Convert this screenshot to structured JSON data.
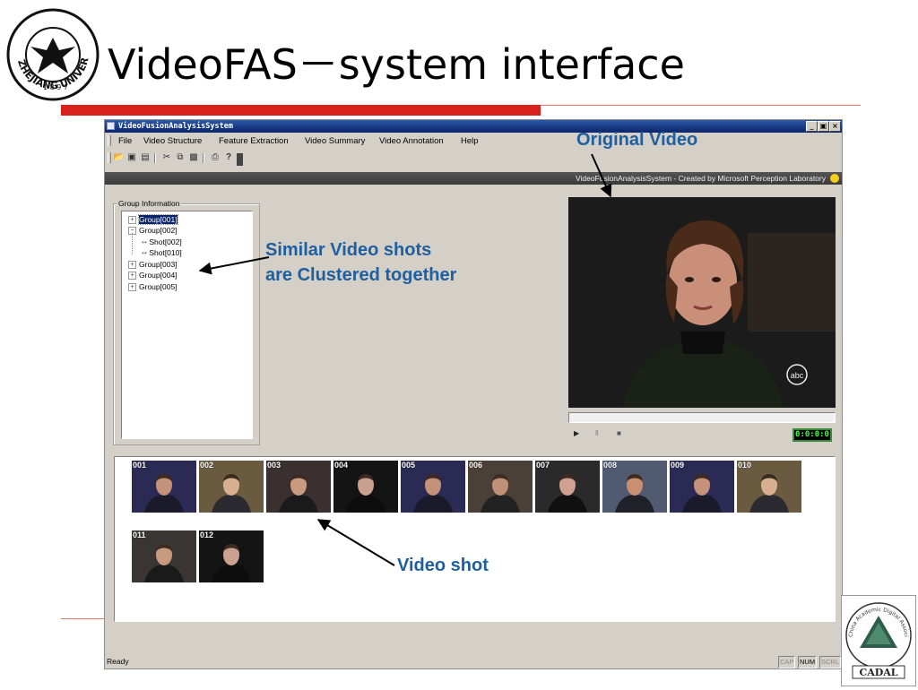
{
  "slide": {
    "title": "VideoFAS－system interface",
    "university_seal_text": "ZHEJIANG UNIVERSITY 1897",
    "cadal_logo_text": "CADAL",
    "cadal_logo_ring_text": "China Academic Digital Associative Library"
  },
  "app": {
    "window_title": "VideoFusionAnalysisSystem",
    "window_buttons": [
      "_",
      "▣",
      "×"
    ],
    "menu": [
      "File",
      "Video Structure",
      "Feature Extraction",
      "Video Summary",
      "Video Annotation",
      "Help"
    ],
    "toolbar_icons": [
      "open-icon",
      "save-icon",
      "properties-icon",
      "cut-icon",
      "copy-icon",
      "paste-icon",
      "print-icon",
      "help-icon"
    ],
    "banner": "VideoFusionAnalysisSystem - Created by Microsoft Perception Laboratory",
    "group_panel": {
      "legend": "Group Information",
      "tree": [
        {
          "label": "Group[001]",
          "expander": "+",
          "level": 0,
          "selected": true
        },
        {
          "label": "Group[002]",
          "expander": "−",
          "level": 0,
          "selected": false
        },
        {
          "label": "Shot[002]",
          "expander": "",
          "level": 1,
          "selected": false
        },
        {
          "label": "Shot[010]",
          "expander": "",
          "level": 1,
          "selected": false
        },
        {
          "label": "Group[003]",
          "expander": "+",
          "level": 0,
          "selected": false
        },
        {
          "label": "Group[004]",
          "expander": "+",
          "level": 0,
          "selected": false
        },
        {
          "label": "Group[005]",
          "expander": "+",
          "level": 0,
          "selected": false
        }
      ]
    },
    "player": {
      "watermark": "abc",
      "controls": [
        "▶",
        "‖",
        "■"
      ],
      "timecode": "0:0:0:0"
    },
    "shots": [
      "001",
      "002",
      "003",
      "004",
      "005",
      "006",
      "007",
      "008",
      "009",
      "010",
      "011",
      "012"
    ],
    "status": {
      "text": "Ready",
      "indicators": [
        {
          "label": "CAP",
          "on": false
        },
        {
          "label": "NUM",
          "on": true
        },
        {
          "label": "SCRL",
          "on": false
        }
      ]
    }
  },
  "callouts": {
    "original_video": "Original Video",
    "similar_line1": "Similar Video shots",
    "similar_line2": "are Clustered together",
    "video_shot": "Video shot"
  },
  "colors": {
    "accent_red": "#d8201c",
    "callout_blue": "#1f5fa0",
    "titlebar_blue": "#0a246a",
    "timecode_green": "#44ff44"
  }
}
